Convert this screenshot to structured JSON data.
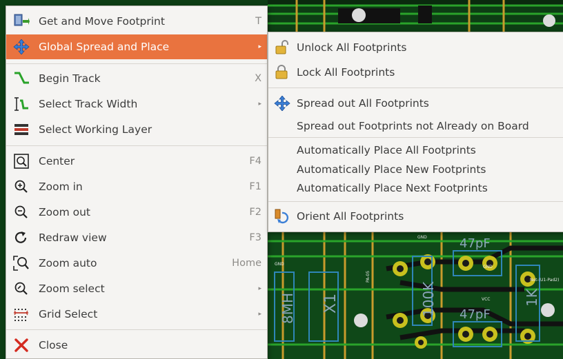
{
  "colors": {
    "menu_bg": "#f5f4f2",
    "highlight": "#e9733f",
    "pcb_green": "#0d3d14",
    "shortcut_text": "#8d8b88"
  },
  "main_menu": {
    "items": [
      {
        "label": "Get and Move Footprint",
        "shortcut": "T",
        "icon": "move-footprint-icon"
      },
      {
        "label": "Global Spread and Place",
        "shortcut": "",
        "icon": "spread-arrows-icon",
        "submenu": true,
        "highlighted": true
      },
      {
        "label": "Begin Track",
        "shortcut": "X",
        "icon": "track-icon"
      },
      {
        "label": "Select Track Width",
        "shortcut": "",
        "icon": "track-width-icon",
        "submenu": true
      },
      {
        "label": "Select Working Layer",
        "shortcut": "",
        "icon": "layers-icon"
      },
      {
        "label": "Center",
        "shortcut": "F4",
        "icon": "center-icon"
      },
      {
        "label": "Zoom in",
        "shortcut": "F1",
        "icon": "zoom-in-icon"
      },
      {
        "label": "Zoom out",
        "shortcut": "F2",
        "icon": "zoom-out-icon"
      },
      {
        "label": "Redraw view",
        "shortcut": "F3",
        "icon": "redraw-icon"
      },
      {
        "label": "Zoom auto",
        "shortcut": "Home",
        "icon": "zoom-auto-icon"
      },
      {
        "label": "Zoom select",
        "shortcut": "",
        "icon": "zoom-select-icon",
        "submenu": true
      },
      {
        "label": "Grid Select",
        "shortcut": "",
        "icon": "grid-icon",
        "submenu": true
      },
      {
        "label": "Close",
        "shortcut": "",
        "icon": "close-icon"
      }
    ]
  },
  "submenu": {
    "items": [
      {
        "label": "Unlock All Footprints",
        "icon": "unlock-icon"
      },
      {
        "label": "Lock All Footprints",
        "icon": "lock-icon"
      },
      {
        "label": "Spread out All Footprints",
        "icon": "spread-arrows-icon"
      },
      {
        "label": "Spread out Footprints not Already on Board"
      },
      {
        "label": "Automatically Place All Footprints"
      },
      {
        "label": "Automatically Place New Footprints"
      },
      {
        "label": "Automatically Place Next Footprints"
      },
      {
        "label": "Orient All Footprints",
        "icon": "orient-icon"
      }
    ]
  },
  "pcb_labels": {
    "cap1": "47pF",
    "cap2": "47pF",
    "res1": "100K",
    "res2": "1K",
    "crystal": "X1",
    "inductor": "8MH",
    "gnd_a": "GND",
    "gnd_b": "GND",
    "gnd_c": "GND",
    "vcc": "VCC",
    "net": "Net-(U1-Pad2)",
    "pa5": "PA-05"
  }
}
